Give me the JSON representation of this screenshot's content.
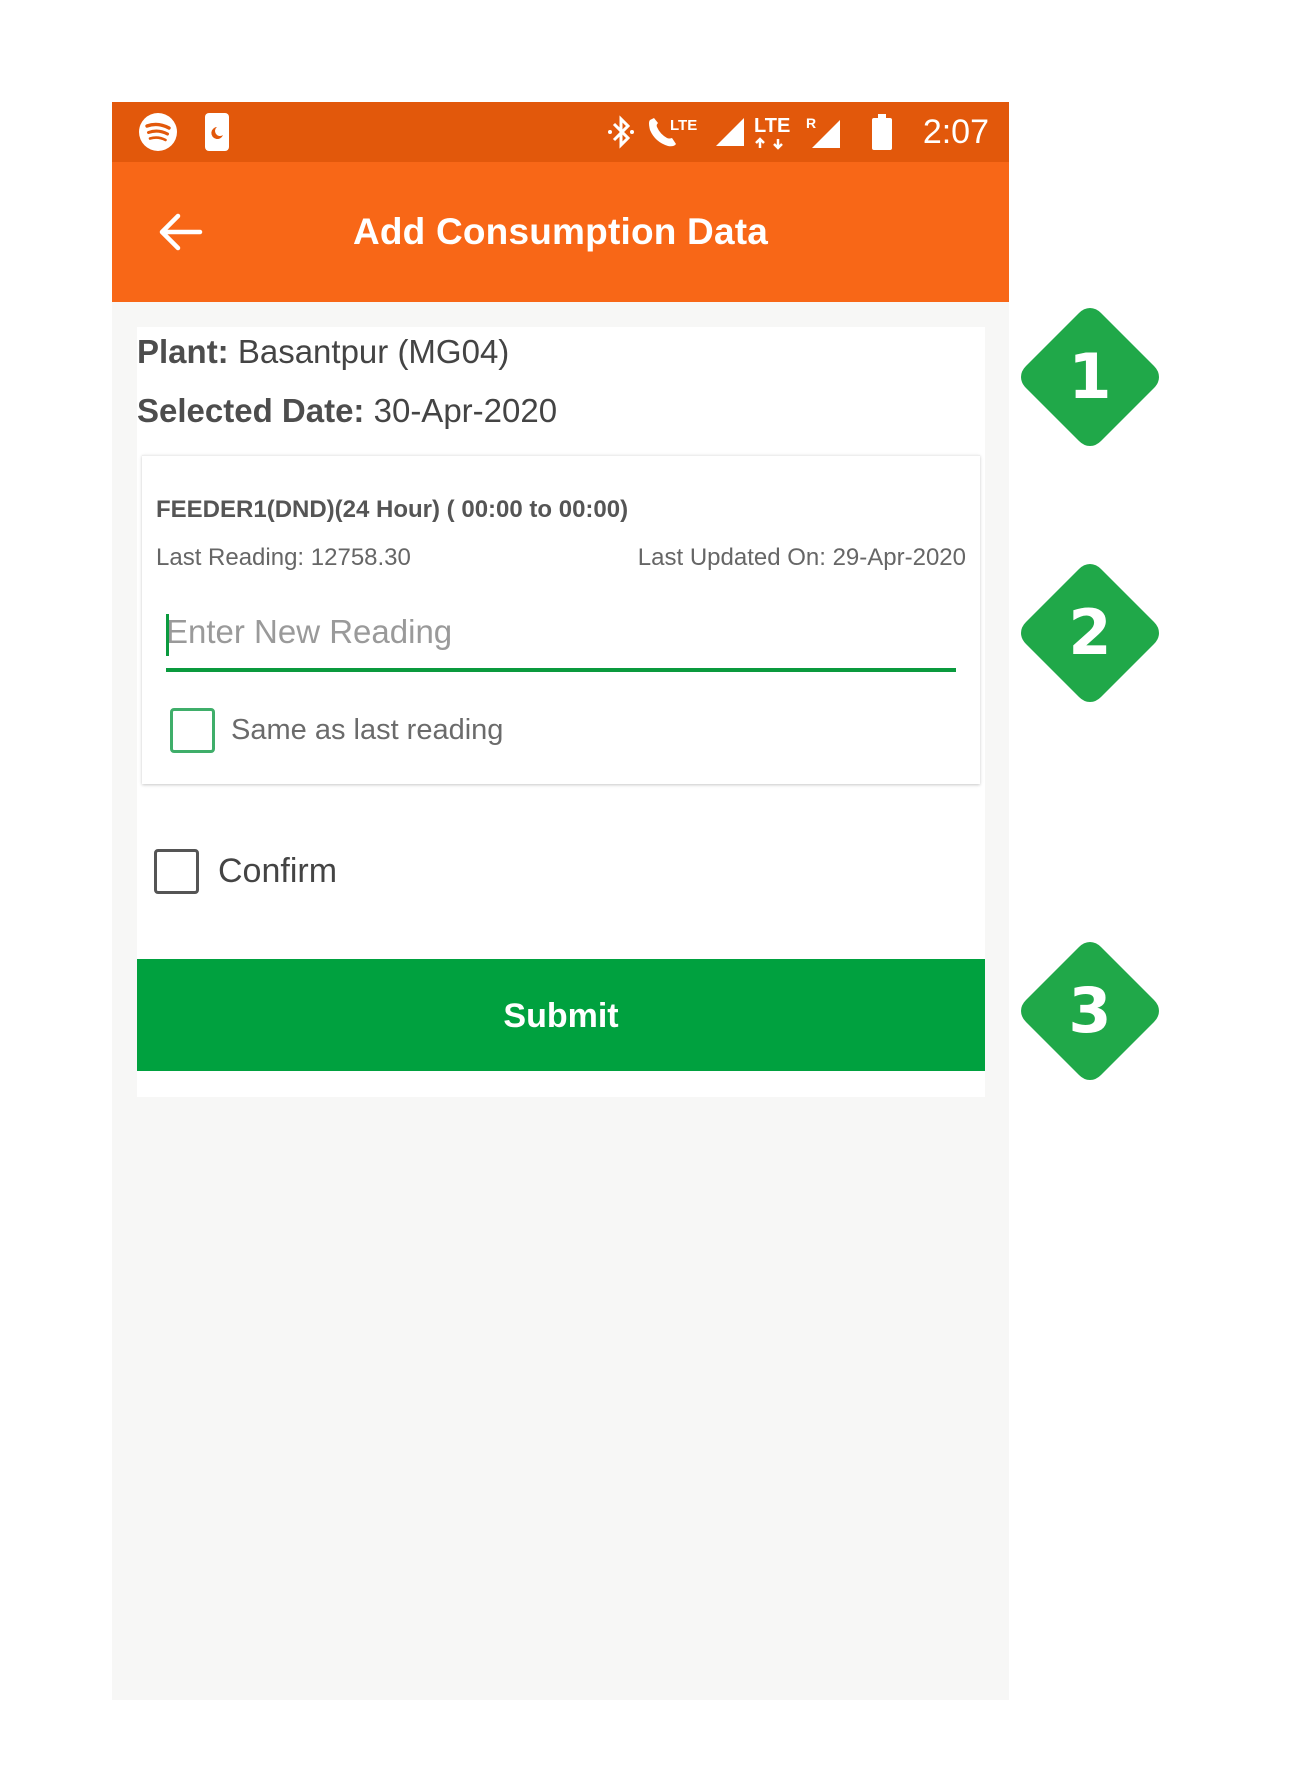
{
  "status_bar": {
    "time": "2:07",
    "icons": [
      "spotify-icon",
      "moon-icon",
      "bluetooth-icon",
      "volte-call-icon",
      "signal-icon",
      "lte-icon",
      "roaming-signal-icon",
      "battery-icon"
    ],
    "icon_texts": {
      "volte": "LTE",
      "lte": "LTE",
      "roaming": "R"
    }
  },
  "toolbar": {
    "title": "Add Consumption Data",
    "back_icon": "arrow-left-icon"
  },
  "info": {
    "plant_label": "Plant:",
    "plant_value": "Basantpur (MG04)",
    "date_label": "Selected Date:",
    "date_value": "30-Apr-2020"
  },
  "feeder": {
    "name": "FEEDER1(DND)(24 Hour) ( 00:00 to 00:00)",
    "last_reading": "Last Reading: 12758.30",
    "last_updated": "Last Updated On: 29-Apr-2020",
    "input_placeholder": "Enter New Reading",
    "input_value": "",
    "same_as_last_label": "Same as last reading",
    "same_as_last_checked": false
  },
  "confirm": {
    "label": "Confirm",
    "checked": false
  },
  "submit": {
    "label": "Submit"
  },
  "callouts": [
    "1",
    "2",
    "3"
  ],
  "colors": {
    "status_bar": "#e2580b",
    "toolbar": "#f86717",
    "accent_green": "#00a13f",
    "callout_green": "#20a849"
  }
}
